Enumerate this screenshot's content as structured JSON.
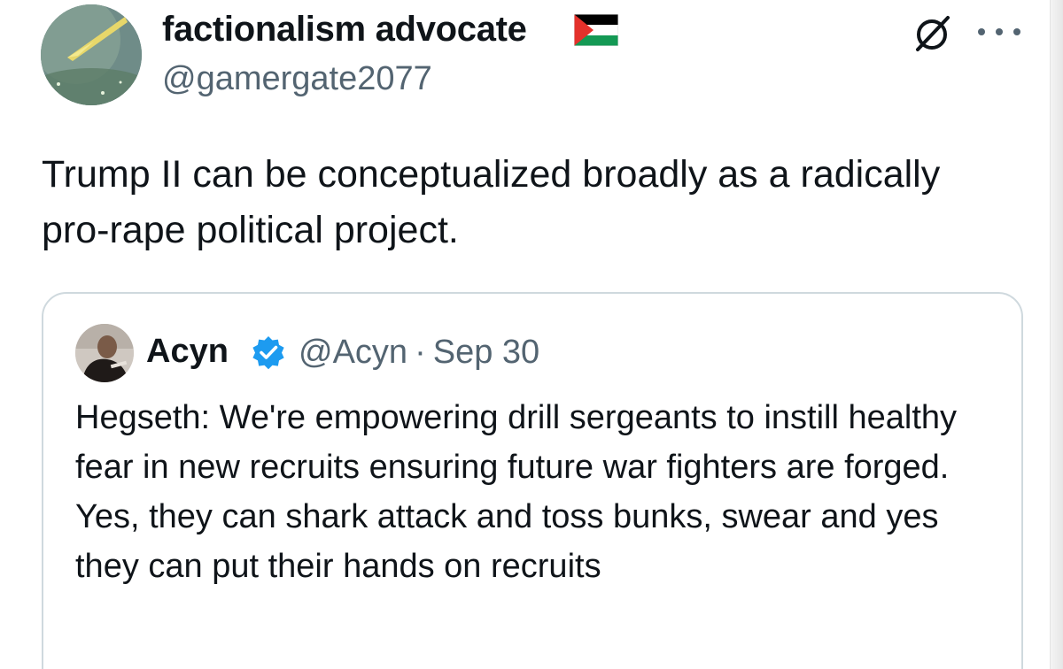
{
  "post": {
    "author": {
      "display_name": "factionalism advocate",
      "handle": "@gamergate2077",
      "flag_icon": "palestine-flag-icon"
    },
    "text": "Trump II can be conceptualized broadly as a radically pro-rape political project.",
    "actions": {
      "grok_icon": "grok-icon",
      "more_icon": "more-horizontal-icon"
    }
  },
  "quoted_post": {
    "author": {
      "display_name": "Acyn",
      "handle": "@Acyn",
      "verified_icon": "verified-badge-icon"
    },
    "separator": "·",
    "date": "Sep 30",
    "text": "Hegseth: We're empowering drill sergeants to instill healthy fear in new recruits ensuring future war fighters are forged. Yes, they can shark attack and toss bunks, swear and yes they can put their hands on recruits"
  },
  "colors": {
    "text_primary": "#0f1419",
    "text_secondary": "#536471",
    "border": "#cfd9de",
    "verified": "#1d9bf0"
  }
}
